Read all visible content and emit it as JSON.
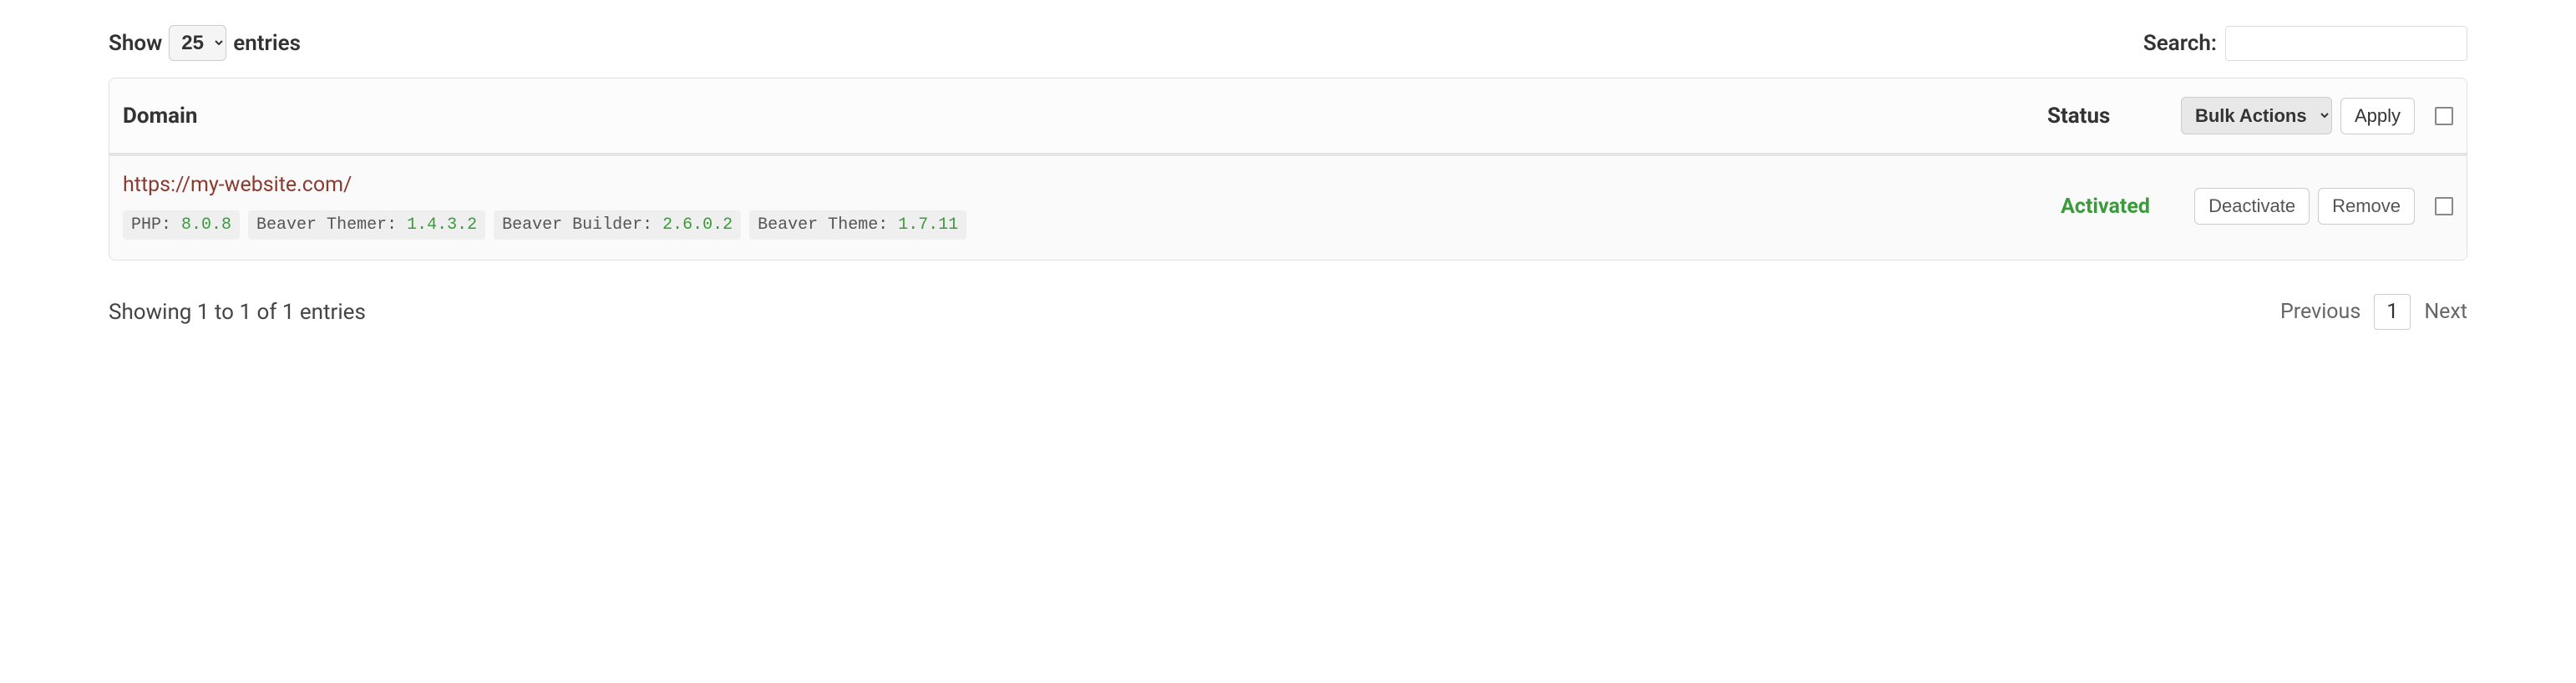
{
  "top": {
    "show_label_pre": "Show",
    "show_label_post": "entries",
    "page_size": "25",
    "search_label": "Search:"
  },
  "header": {
    "domain": "Domain",
    "status": "Status",
    "bulk_actions": "Bulk Actions",
    "apply": "Apply"
  },
  "rows": [
    {
      "url": "https://my-website.com/",
      "status": "Activated",
      "tags": [
        {
          "label": "PHP:",
          "version": "8.0.8"
        },
        {
          "label": "Beaver Themer:",
          "version": "1.4.3.2"
        },
        {
          "label": "Beaver Builder:",
          "version": "2.6.0.2"
        },
        {
          "label": "Beaver Theme:",
          "version": "1.7.11"
        }
      ],
      "actions": {
        "deactivate": "Deactivate",
        "remove": "Remove"
      }
    }
  ],
  "footer": {
    "info": "Showing 1 to 1 of 1 entries",
    "previous": "Previous",
    "current_page": "1",
    "next": "Next"
  }
}
